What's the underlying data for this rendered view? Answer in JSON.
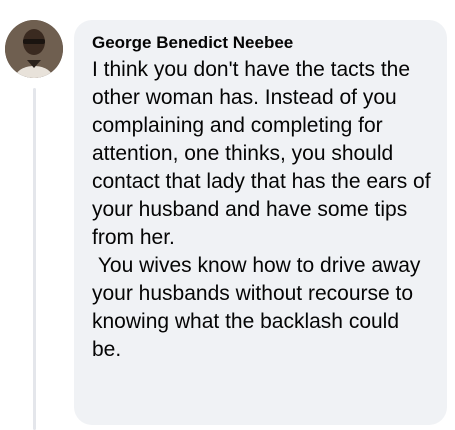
{
  "comment": {
    "author": "George Benedict Neebee",
    "text": "I think you don't have the tacts the other woman has. Instead of you complaining and completing for attention, one thinks, you should contact that lady that has the ears of your husband and have some tips from her.\n You wives know how to drive away your husbands without recourse to knowing what the backlash could be.",
    "avatar_icon": "profile-photo"
  },
  "colors": {
    "bubble_background": "#f0f2f5",
    "text": "#050505",
    "thread_line": "#e4e6eb"
  }
}
